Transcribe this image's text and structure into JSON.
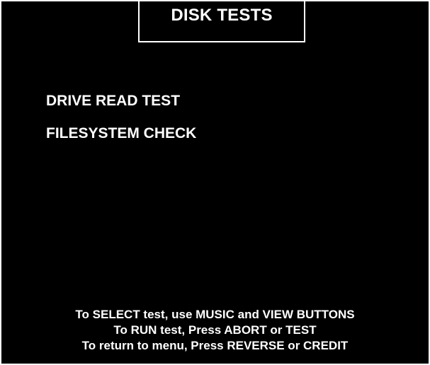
{
  "screen": {
    "title": "DISK TESTS",
    "menu_items": [
      {
        "label": "DRIVE READ TEST"
      },
      {
        "label": "FILESYSTEM CHECK"
      }
    ],
    "instructions": [
      "To SELECT test, use MUSIC and VIEW BUTTONS",
      "To RUN test, Press ABORT or TEST",
      "To return to menu, Press REVERSE or CREDIT"
    ]
  },
  "colors": {
    "background": "#000000",
    "text": "#ffffff"
  }
}
